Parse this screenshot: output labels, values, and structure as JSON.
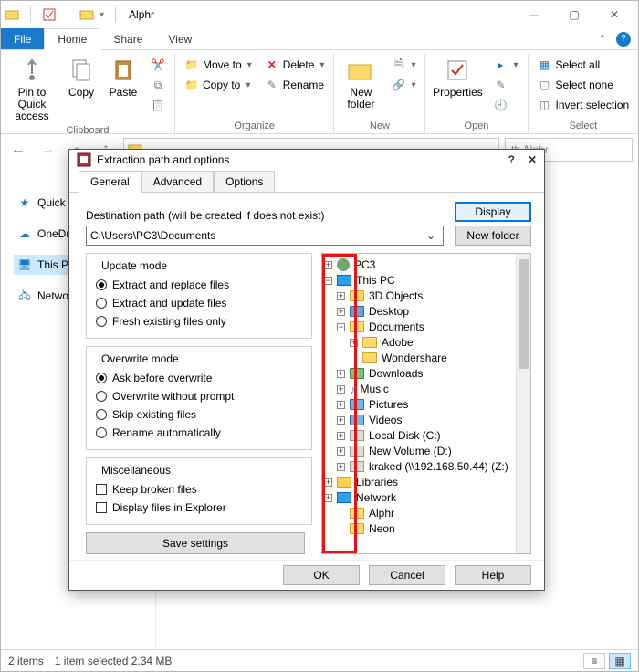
{
  "window": {
    "title": "Alphr",
    "controls": {
      "min": "—",
      "max": "▢",
      "close": "✕"
    }
  },
  "tabs": {
    "file": "File",
    "home": "Home",
    "share": "Share",
    "view": "View"
  },
  "ribbon": {
    "clipboard": {
      "label": "Clipboard",
      "pin": "Pin to Quick access",
      "copy": "Copy",
      "paste": "Paste"
    },
    "organize": {
      "label": "Organize",
      "moveTo": "Move to",
      "copyTo": "Copy to",
      "delete": "Delete",
      "rename": "Rename"
    },
    "new": {
      "label": "New",
      "newFolder": "New folder"
    },
    "open": {
      "label": "Open",
      "properties": "Properties"
    },
    "select": {
      "label": "Select",
      "selectAll": "Select all",
      "selectNone": "Select none",
      "invert": "Invert selection"
    }
  },
  "address": {
    "searchPlaceholder": "th Alphr"
  },
  "navpane": {
    "quick": "Quick",
    "onedrive": "OneDr",
    "thispc": "This P",
    "network": "Netwo"
  },
  "statusbar": {
    "items": "2 items",
    "selected": "1 item selected  2.34 MB"
  },
  "dialog": {
    "title": "Extraction path and options",
    "help": "?",
    "close": "✕",
    "tabs": {
      "general": "General",
      "advanced": "Advanced",
      "options": "Options"
    },
    "destLabel": "Destination path (will be created if does not exist)",
    "destPath": "C:\\Users\\PC3\\Documents",
    "displayBtn": "Display",
    "newFolderBtn": "New folder",
    "updateMode": {
      "title": "Update mode",
      "opt1": "Extract and replace files",
      "opt2": "Extract and update files",
      "opt3": "Fresh existing files only"
    },
    "overwriteMode": {
      "title": "Overwrite mode",
      "opt1": "Ask before overwrite",
      "opt2": "Overwrite without prompt",
      "opt3": "Skip existing files",
      "opt4": "Rename automatically"
    },
    "misc": {
      "title": "Miscellaneous",
      "opt1": "Keep broken files",
      "opt2": "Display files in Explorer"
    },
    "saveSettings": "Save settings",
    "tree": {
      "pc3": "PC3",
      "thispc": "This PC",
      "objects3d": "3D Objects",
      "desktop": "Desktop",
      "documents": "Documents",
      "adobe": "Adobe",
      "wondershare": "Wondershare",
      "downloads": "Downloads",
      "music": "Music",
      "pictures": "Pictures",
      "videos": "Videos",
      "localdisk": "Local Disk (C:)",
      "newvolume": "New Volume (D:)",
      "kraked": "kraked (\\\\192.168.50.44) (Z:)",
      "libraries": "Libraries",
      "network": "Network",
      "alphr": "Alphr",
      "neon": "Neon"
    },
    "footer": {
      "ok": "OK",
      "cancel": "Cancel",
      "help": "Help"
    }
  }
}
